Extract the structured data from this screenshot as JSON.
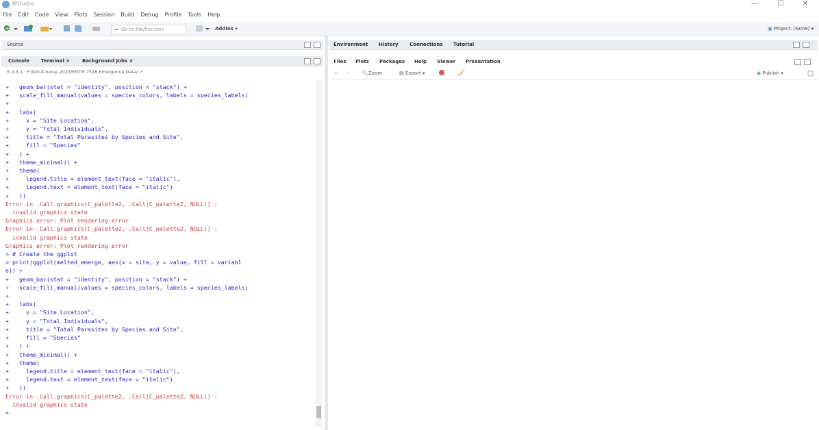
{
  "window": {
    "title": "RStudio",
    "controls": {
      "minimize": "—",
      "maximize": "☐",
      "close": "✕"
    }
  },
  "menu": [
    "File",
    "Edit",
    "Code",
    "View",
    "Plots",
    "Session",
    "Build",
    "Debug",
    "Profile",
    "Tools",
    "Help"
  ],
  "toolbar": {
    "goto_placeholder": "Go to file/function",
    "addins": "Addins ▾",
    "project": "Project: (None) ▾"
  },
  "source_pane": {
    "title": "Source"
  },
  "console_pane": {
    "tabs": [
      "Console",
      "Terminal ×",
      "Background Jobs ×"
    ],
    "path": "R 4.3.1 · F:/Doc/Course 2023/ENTM 7516 Emergence Data/ ↗",
    "lines": [
      {
        "t": "+   geom_bar(stat = \"identity\", position = \"stack\") +",
        "k": "in"
      },
      {
        "t": "+   scale_fill_manual(values = species_colors, labels = species_labels)",
        "k": "in"
      },
      {
        "t": "+ ",
        "k": "in"
      },
      {
        "t": "+   labs(",
        "k": "in"
      },
      {
        "t": "+     x = \"Site Location\",",
        "k": "in"
      },
      {
        "t": "+     y = \"Total Individuals\",",
        "k": "in"
      },
      {
        "t": "+     title = \"Total Parasites by Species and Site\",",
        "k": "in"
      },
      {
        "t": "+     fill = \"Species\"",
        "k": "in"
      },
      {
        "t": "+   ) +",
        "k": "in"
      },
      {
        "t": "+   theme_minimal() +",
        "k": "in"
      },
      {
        "t": "+   theme(",
        "k": "in"
      },
      {
        "t": "+     legend.title = element_text(face = \"italic\"),",
        "k": "in"
      },
      {
        "t": "+     legend.text = element_text(face = \"italic\")",
        "k": "in"
      },
      {
        "t": "+   ))",
        "k": "in"
      },
      {
        "t": "Error in .Call.graphics(C_palette2, .Call(C_palette2, NULL)) :",
        "k": "err"
      },
      {
        "t": "  invalid graphics state",
        "k": "err"
      },
      {
        "t": "Graphics error: Plot rendering error",
        "k": "err"
      },
      {
        "t": "Error in .Call.graphics(C_palette2, .Call(C_palette2, NULL)) :",
        "k": "err"
      },
      {
        "t": "  invalid graphics state",
        "k": "err"
      },
      {
        "t": "Graphics error: Plot rendering error",
        "k": "err"
      },
      {
        "t": "> # Create the ggplot",
        "k": "in"
      },
      {
        "t": "> print(ggplot(melted_emerge, aes(x = site, y = value, fill = variabl",
        "k": "in"
      },
      {
        "t": "e)) +",
        "k": "in"
      },
      {
        "t": "+   geom_bar(stat = \"identity\", position = \"stack\") +",
        "k": "in"
      },
      {
        "t": "+   scale_fill_manual(values = species_colors, labels = species_labels)",
        "k": "in"
      },
      {
        "t": "+ ",
        "k": "in"
      },
      {
        "t": "+   labs(",
        "k": "in"
      },
      {
        "t": "+     x = \"Site Location\",",
        "k": "in"
      },
      {
        "t": "+     y = \"Total Individuals\",",
        "k": "in"
      },
      {
        "t": "+     title = \"Total Parasites by Species and Site\",",
        "k": "in"
      },
      {
        "t": "+     fill = \"Species\"",
        "k": "in"
      },
      {
        "t": "+   ) +",
        "k": "in"
      },
      {
        "t": "+   theme_minimal() +",
        "k": "in"
      },
      {
        "t": "+   theme(",
        "k": "in"
      },
      {
        "t": "+     legend.title = element_text(face = \"italic\"),",
        "k": "in"
      },
      {
        "t": "+     legend.text = element_text(face = \"italic\")",
        "k": "in"
      },
      {
        "t": "+   ))",
        "k": "in"
      },
      {
        "t": "Error in .Call.graphics(C_palette2, .Call(C_palette2, NULL)) :",
        "k": "err"
      },
      {
        "t": "  invalid graphics state",
        "k": "err"
      },
      {
        "t": "> ",
        "k": "prompt"
      }
    ]
  },
  "env_pane": {
    "tabs": [
      "Environment",
      "History",
      "Connections",
      "Tutorial"
    ]
  },
  "files_pane": {
    "tabs": [
      "Files",
      "Plots",
      "Packages",
      "Help",
      "Viewer",
      "Presentation"
    ],
    "zoom": "Zoom",
    "export": "Export ▾",
    "publish": "Publish ▾"
  },
  "colors": {
    "input": "#2222c8",
    "error": "#c0393b",
    "pane_header": "#e9ecf0"
  }
}
